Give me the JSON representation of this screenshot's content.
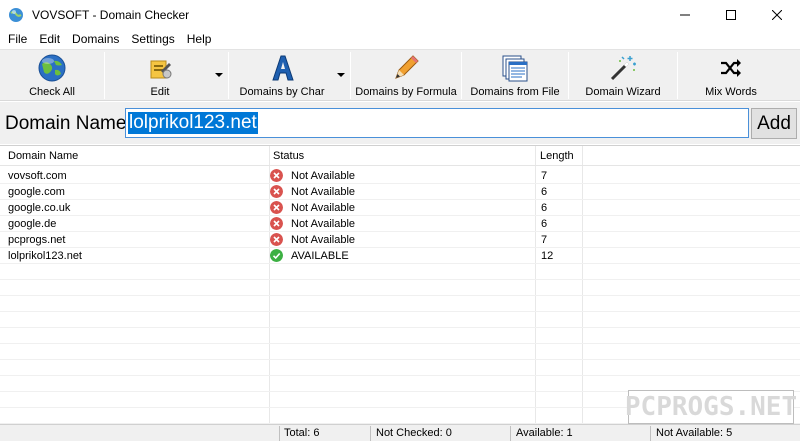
{
  "window": {
    "title": "VOVSOFT - Domain Checker",
    "controls": [
      "minimize-icon",
      "maximize-icon",
      "close-icon"
    ]
  },
  "menu": [
    "File",
    "Edit",
    "Domains",
    "Settings",
    "Help"
  ],
  "toolbar": {
    "check_all": "Check All",
    "edit": "Edit",
    "domains_by_char": "Domains by Char",
    "domains_by_formula": "Domains by Formula",
    "domains_from_file": "Domains from File",
    "domain_wizard": "Domain Wizard",
    "mix_words": "Mix Words"
  },
  "domain_entry": {
    "label": "Domain Name:",
    "value": "lolprikol123.net",
    "add_label": "Add"
  },
  "table": {
    "columns": [
      "Domain Name",
      "Status",
      "Length"
    ],
    "rows": [
      {
        "domain": "vovsoft.com",
        "status": "Not Available",
        "available": false,
        "length": "7"
      },
      {
        "domain": "google.com",
        "status": "Not Available",
        "available": false,
        "length": "6"
      },
      {
        "domain": "google.co.uk",
        "status": "Not Available",
        "available": false,
        "length": "6"
      },
      {
        "domain": "google.de",
        "status": "Not Available",
        "available": false,
        "length": "6"
      },
      {
        "domain": "pcprogs.net",
        "status": "Not Available",
        "available": false,
        "length": "7"
      },
      {
        "domain": "lolprikol123.net",
        "status": "AVAILABLE",
        "available": true,
        "length": "12"
      }
    ]
  },
  "statusbar": {
    "total": "Total: 6",
    "not_checked": "Not Checked: 0",
    "available": "Available: 1",
    "not_available": "Not Available: 5"
  },
  "watermark": "PCPROGS.NET",
  "colors": {
    "error_red": "#d9534f",
    "ok_green": "#3cb043",
    "selection_blue": "#0078d7"
  }
}
